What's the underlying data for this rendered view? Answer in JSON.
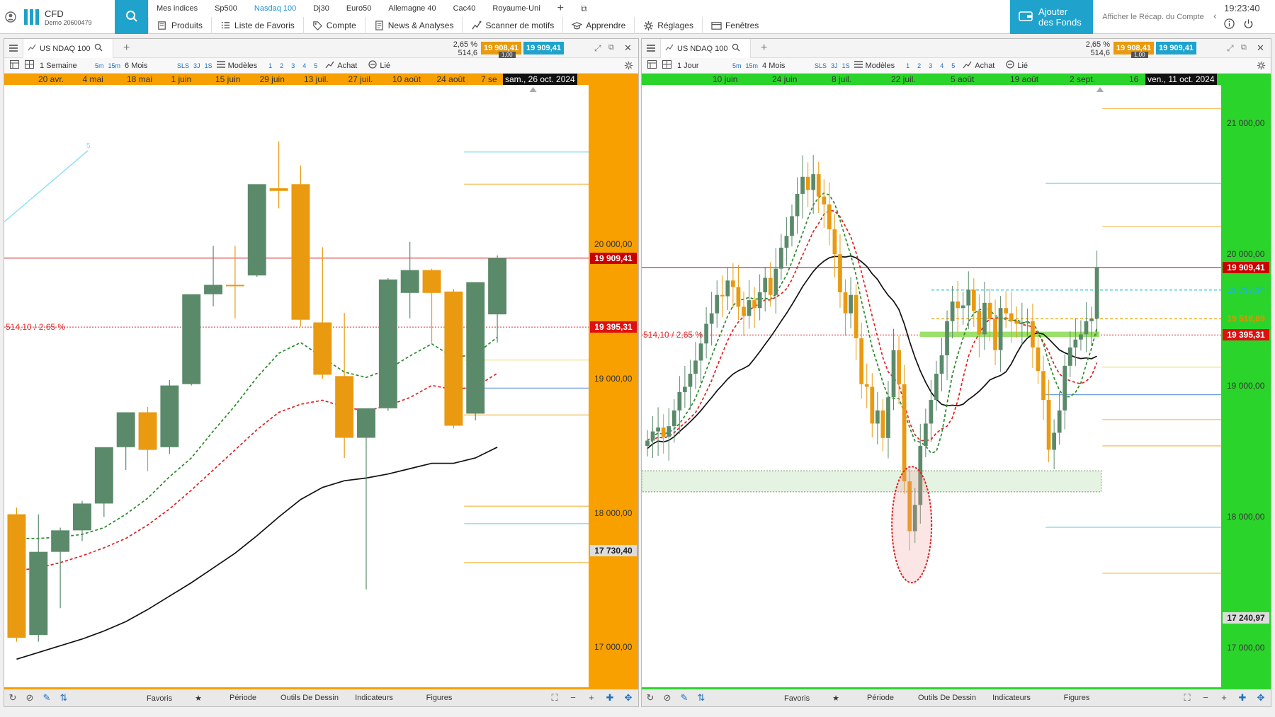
{
  "app": {
    "user_icon": "user-icon",
    "name": "CFD",
    "account": "Demo 20600479",
    "search_icon": "search-icon"
  },
  "indices": [
    "Mes indices",
    "Sp500",
    "Nasdaq 100",
    "Dj30",
    "Euro50",
    "Allemagne 40",
    "Cac40",
    "Royaume-Uni"
  ],
  "active_index": "Nasdaq 100",
  "menu": [
    {
      "label": "Produits",
      "icon": "book-icon"
    },
    {
      "label": "Liste de Favoris",
      "icon": "list-icon"
    },
    {
      "label": "Compte",
      "icon": "tag-icon"
    },
    {
      "label": "News & Analyses",
      "icon": "document-icon"
    },
    {
      "label": "Scanner de motifs",
      "icon": "pattern-icon"
    },
    {
      "label": "Apprendre",
      "icon": "graduation-icon"
    },
    {
      "label": "Réglages",
      "icon": "gear-icon"
    },
    {
      "label": "Fenêtres",
      "icon": "window-icon"
    }
  ],
  "add_funds": "Ajouter\ndes Fonds",
  "recap": "Afficher le Récap. du Compte",
  "time": "19:23:40",
  "colors": {
    "up": "#5b8a6b",
    "down": "#e99a10",
    "accent": "#1fa3cd",
    "orange_axis": "#f7a000",
    "green_axis": "#2bd42b",
    "red": "#d20000"
  },
  "panels": [
    {
      "tab": "US NDAQ 100",
      "change_pct": "2,65 %",
      "change_pts": "514,6",
      "sell": "19 908,41",
      "buy": "19 909,41",
      "lot": "1,00",
      "period": "1 Semaine",
      "frames": [
        "5m",
        "15m"
      ],
      "range": "6 Mois",
      "sls": [
        "SLS",
        "3J",
        "1S"
      ],
      "models": "Modèles",
      "nums": [
        "1",
        "2",
        "3",
        "4",
        "5"
      ],
      "achat": "Achat",
      "lie": "Lié",
      "dates": [
        "20 avr.",
        "4 mai",
        "18 mai",
        "1 juin",
        "15 juin",
        "29 juin",
        "13 juil.",
        "27 juil.",
        "10 août",
        "24 août",
        "7 se"
      ],
      "cursor_date": "sam., 26 oct. 2024",
      "price_levels": [
        "20 000,00",
        "19 000,00",
        "18 000,00",
        "17 000,00"
      ],
      "last_price": "19 909,41",
      "ref_price": "19 395,31",
      "low_price": "17 730,40",
      "change_label": "514,10 / 2,65 %",
      "fib_label": "5",
      "bottom": [
        "Favoris",
        "Période",
        "Outils De Dessin",
        "Indicateurs",
        "Figures"
      ]
    },
    {
      "tab": "US NDAQ 100",
      "change_pct": "2,65 %",
      "change_pts": "514,6",
      "sell": "19 908,41",
      "buy": "19 909,41",
      "lot": "1,00",
      "period": "1 Jour",
      "frames": [
        "5m",
        "15m"
      ],
      "range": "4 Mois",
      "sls": [
        "SLS",
        "3J",
        "1S"
      ],
      "models": "Modèles",
      "nums": [
        "1",
        "2",
        "3",
        "4",
        "5"
      ],
      "achat": "Achat",
      "lie": "Lié",
      "dates": [
        "10 juin",
        "24 juin",
        "8 juil.",
        "22 juil.",
        "5 août",
        "19 août",
        "2 sept.",
        "16"
      ],
      "cursor_date": "ven., 11 oct. 2024",
      "price_levels": [
        "21 000,00",
        "20 000,00",
        "19 000,00",
        "18 000,00",
        "17 000,00"
      ],
      "last_price": "19 909,41",
      "mid_price": "19 737,34",
      "mid2_price": "19 518,89",
      "ref_price": "19 395,31",
      "low_price": "17 240,97",
      "change_label": "514,10 / 2,65 %",
      "bottom": [
        "Favoris",
        "Période",
        "Outils De Dessin",
        "Indicateurs",
        "Figures"
      ]
    }
  ],
  "chart_data": [
    {
      "type": "candlestick",
      "timeframe": "1 Semaine",
      "candles": [
        {
          "o": 18000,
          "h": 18050,
          "l": 17050,
          "c": 17080
        },
        {
          "o": 17100,
          "h": 18000,
          "l": 17050,
          "c": 17720
        },
        {
          "o": 17720,
          "h": 17900,
          "l": 17300,
          "c": 17880
        },
        {
          "o": 17880,
          "h": 18100,
          "l": 17800,
          "c": 18080
        },
        {
          "o": 18080,
          "h": 18500,
          "l": 17980,
          "c": 18500
        },
        {
          "o": 18500,
          "h": 18750,
          "l": 18330,
          "c": 18760
        },
        {
          "o": 18760,
          "h": 18800,
          "l": 18320,
          "c": 18480
        },
        {
          "o": 18500,
          "h": 19000,
          "l": 18450,
          "c": 18960
        },
        {
          "o": 18970,
          "h": 19640,
          "l": 18960,
          "c": 19640
        },
        {
          "o": 19640,
          "h": 20000,
          "l": 19550,
          "c": 19710
        },
        {
          "o": 19710,
          "h": 20000,
          "l": 19460,
          "c": 19700
        },
        {
          "o": 19780,
          "h": 20450,
          "l": 19770,
          "c": 20460
        },
        {
          "o": 20430,
          "h": 20780,
          "l": 20280,
          "c": 20410
        },
        {
          "o": 20460,
          "h": 20600,
          "l": 19400,
          "c": 19450
        },
        {
          "o": 19430,
          "h": 19990,
          "l": 19010,
          "c": 19040
        },
        {
          "o": 19030,
          "h": 19500,
          "l": 18420,
          "c": 18570
        },
        {
          "o": 18570,
          "h": 18720,
          "l": 17440,
          "c": 18790
        },
        {
          "o": 18790,
          "h": 19760,
          "l": 18770,
          "c": 19750
        },
        {
          "o": 19650,
          "h": 20030,
          "l": 19460,
          "c": 19820
        },
        {
          "o": 19820,
          "h": 19830,
          "l": 19280,
          "c": 19650
        },
        {
          "o": 19660,
          "h": 19680,
          "l": 18640,
          "c": 18660
        },
        {
          "o": 18750,
          "h": 19730,
          "l": 18700,
          "c": 19730
        },
        {
          "o": 19490,
          "h": 19930,
          "l": 19280,
          "c": 19910
        }
      ],
      "ma_green": [
        17820,
        17820,
        17830,
        17850,
        17900,
        18000,
        18120,
        18280,
        18420,
        18620,
        18810,
        19020,
        19200,
        19280,
        19170,
        19060,
        19020,
        19080,
        19180,
        19270,
        19170,
        19190,
        19320
      ],
      "ma_red": [
        17580,
        17600,
        17640,
        17690,
        17750,
        17820,
        17920,
        18040,
        18180,
        18330,
        18480,
        18630,
        18760,
        18820,
        18850,
        18800,
        18770,
        18810,
        18870,
        18960,
        18930,
        18950,
        19050
      ],
      "ma_black": [
        16920,
        16970,
        17020,
        17070,
        17130,
        17200,
        17290,
        17390,
        17490,
        17600,
        17710,
        17840,
        17980,
        18110,
        18200,
        18250,
        18270,
        18300,
        18340,
        18380,
        18380,
        18420,
        18500
      ],
      "last": 19909.41,
      "ref": 19395.31,
      "ylim": [
        16700,
        21200
      ]
    },
    {
      "type": "candlestick",
      "timeframe": "1 Jour",
      "ylim": [
        16700,
        21300
      ],
      "last": 19909.41,
      "ref": 19395.31,
      "levels": [
        19737.34,
        19518.89
      ],
      "support_zone": [
        18200,
        18360
      ]
    }
  ]
}
